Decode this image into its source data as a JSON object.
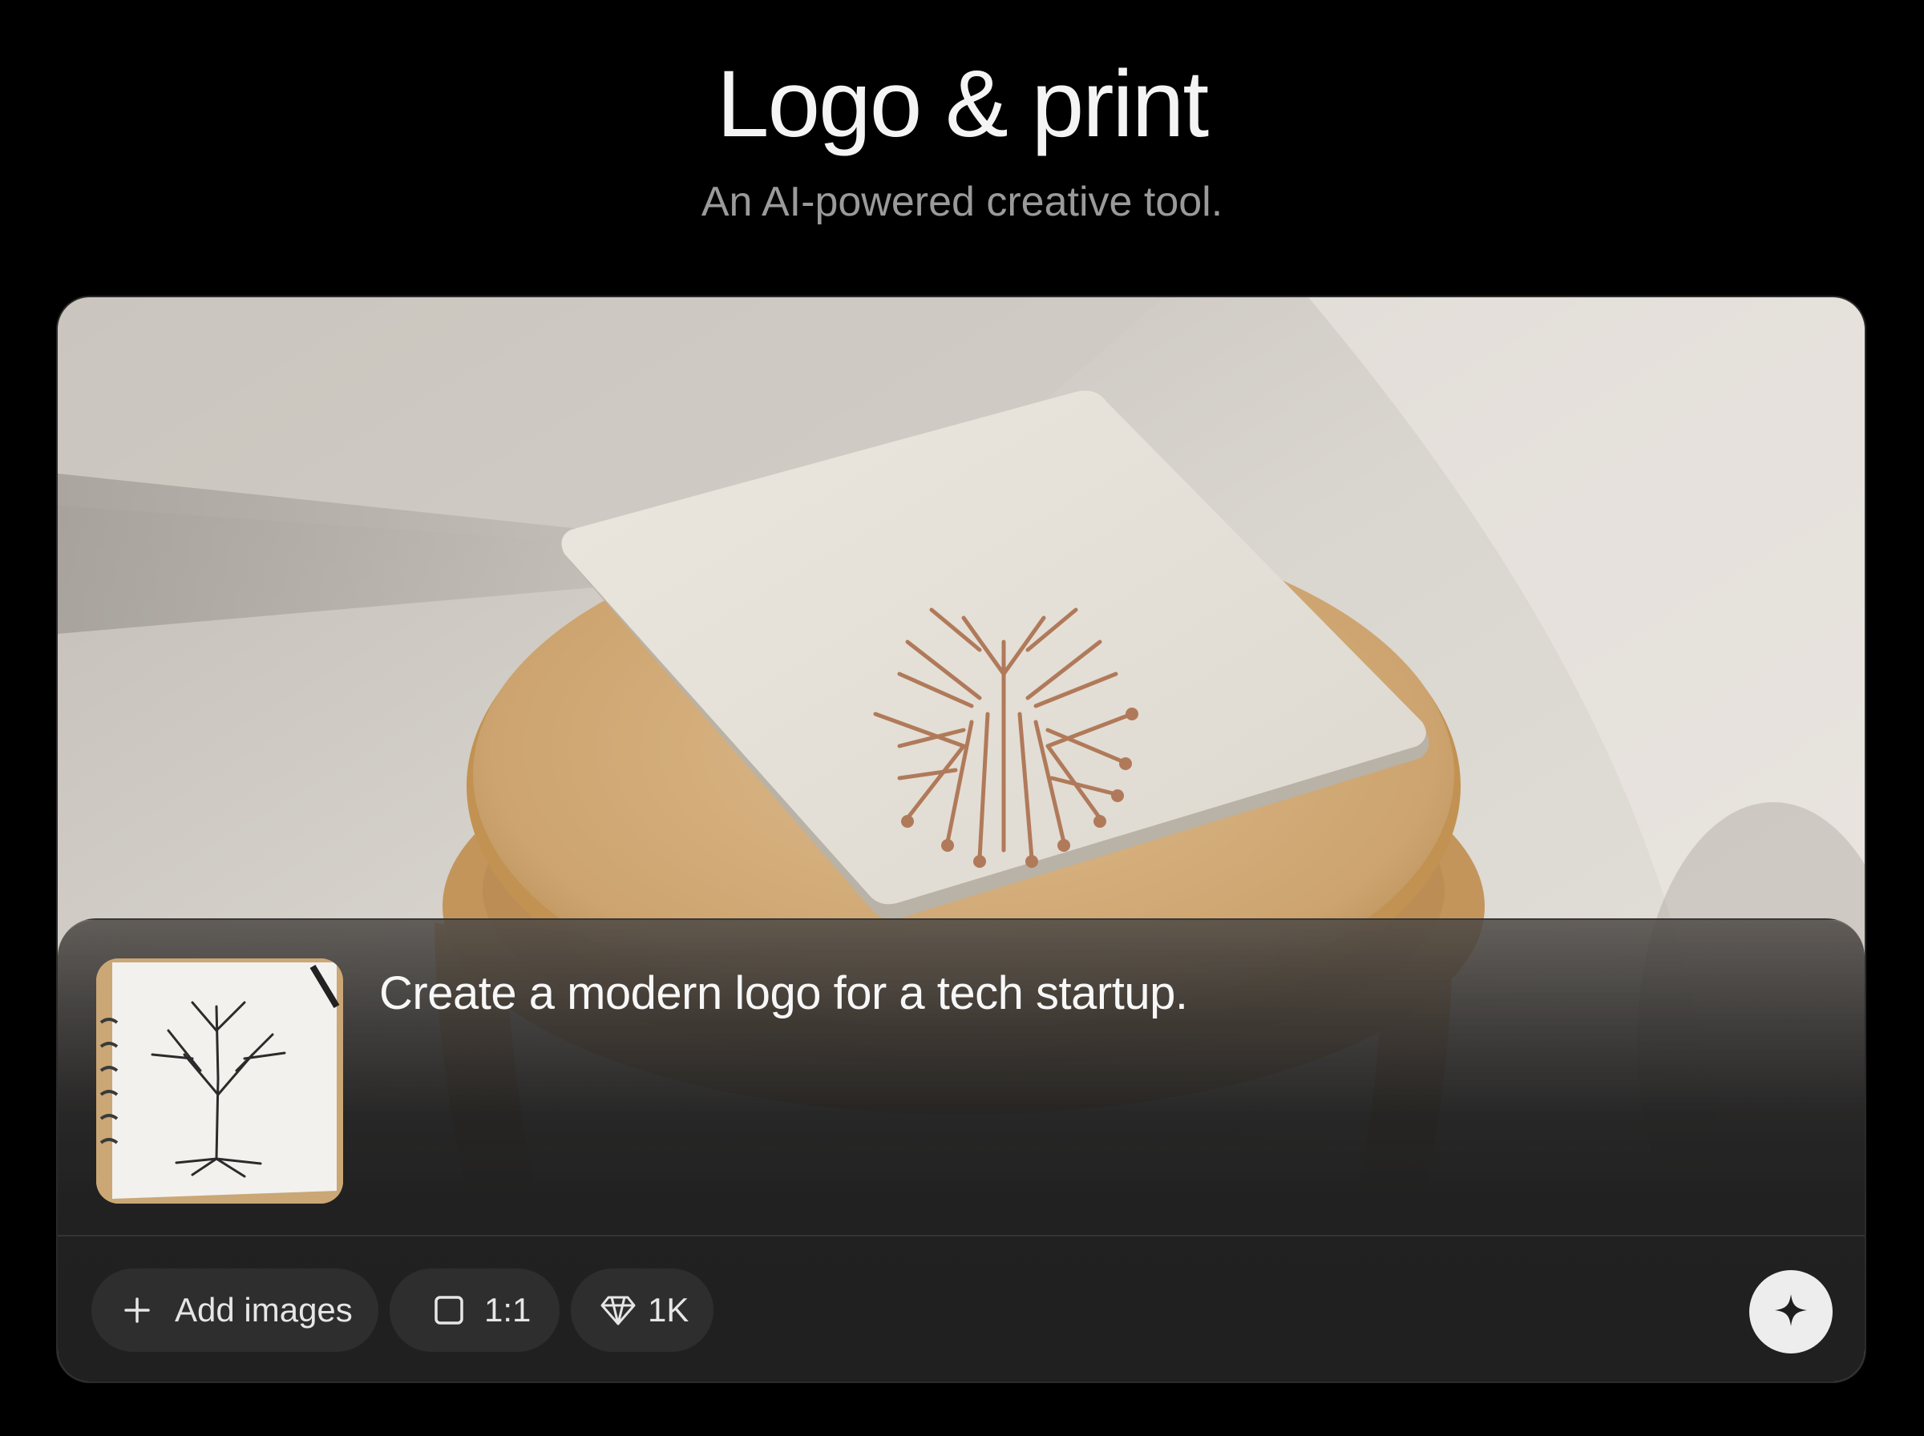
{
  "header": {
    "title": "Logo & print",
    "subtitle": "An AI-powered creative tool."
  },
  "preview": {
    "image_icon": "notebook-with-circuit-tree-logo-on-wooden-stool"
  },
  "composer": {
    "prompt_text": "Create a modern logo for a tech startup.",
    "reference_image_icon": "tree-sketch-notebook-thumbnail",
    "add_images_label": "Add images",
    "add_images_icon": "plus-icon",
    "aspect_ratio_label": "1:1",
    "aspect_ratio_icon": "square-icon",
    "resolution_label": "1K",
    "resolution_icon": "diamond-icon",
    "generate_icon": "sparkle-icon"
  },
  "colors": {
    "background": "#000000",
    "panel": "#212121",
    "chip": "#2e2e2e",
    "generate_button": "#ededed",
    "logo_copper": "#b07a5a"
  }
}
